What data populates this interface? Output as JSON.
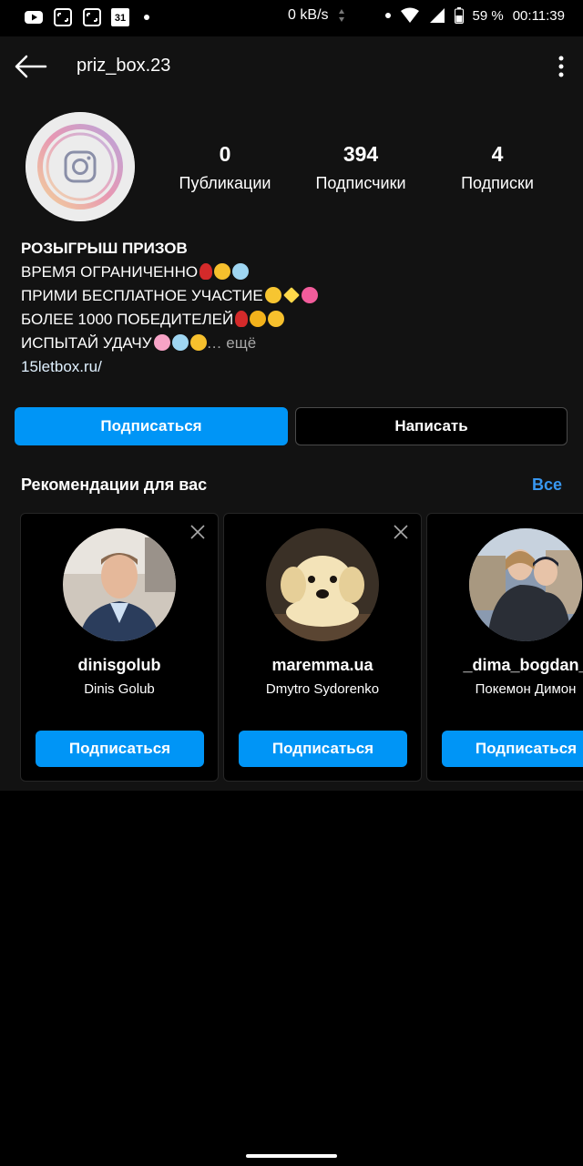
{
  "status_bar": {
    "calendar_day": "31",
    "speed": "0 kB/s",
    "battery": "59 %",
    "time": "00:11:39"
  },
  "header": {
    "username": "priz_box.23",
    "icons": [
      "back-arrow-icon",
      "more-vertical-icon"
    ]
  },
  "profile": {
    "avatar_icon": "instagram-logo-icon",
    "stats": [
      {
        "value": "0",
        "label": "Публикации"
      },
      {
        "value": "394",
        "label": "Подписчики"
      },
      {
        "value": "4",
        "label": "Подписки"
      }
    ],
    "bio": {
      "name": "РОЗЫГРЫШ ПРИЗОВ",
      "line1": "ВРЕМЯ ОГРАНИЧЕННО",
      "line2": "ПРИМИ БЕСПЛАТНОЕ УЧАСТИЕ",
      "line3": "БОЛЕЕ 1000 ПОБЕДИТЕЛЕЙ",
      "line4": "ИСПЫТАЙ УДАЧУ",
      "more": "… ещё",
      "link": "15letbox.ru/"
    },
    "buttons": {
      "follow": "Подписаться",
      "message": "Написать"
    }
  },
  "recommendations": {
    "title": "Рекомендации для вас",
    "see_all": "Все",
    "cards": [
      {
        "username": "dinisgolub",
        "full_name": "Dinis Golub",
        "button": "Подписаться"
      },
      {
        "username": "maremma.ua",
        "full_name": "Dmytro Sydorenko",
        "button": "Подписаться"
      },
      {
        "username": "_dima_bogdan_",
        "full_name": "Покемон Димон",
        "button": "Подписаться"
      }
    ]
  },
  "colors": {
    "accent": "#0095f6",
    "link": "#3897f0",
    "surface": "#121212"
  }
}
